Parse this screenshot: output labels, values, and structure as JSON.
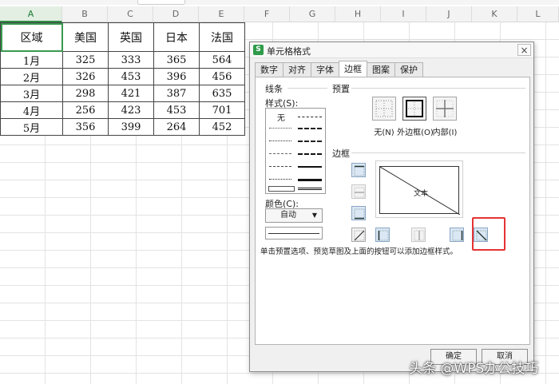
{
  "columns": [
    "A",
    "B",
    "C",
    "D",
    "E",
    "F",
    "G",
    "H",
    "I",
    "J",
    "K",
    "L"
  ],
  "sheet": {
    "header": [
      "区域",
      "美国",
      "英国",
      "日本",
      "法国"
    ],
    "rows": [
      [
        "1月",
        "325",
        "333",
        "365",
        "564"
      ],
      [
        "2月",
        "326",
        "453",
        "396",
        "456"
      ],
      [
        "3月",
        "298",
        "421",
        "387",
        "635"
      ],
      [
        "4月",
        "256",
        "423",
        "453",
        "701"
      ],
      [
        "5月",
        "356",
        "399",
        "264",
        "452"
      ]
    ]
  },
  "dialog": {
    "title": "单元格格式",
    "close_glyph": "×",
    "logo_glyph": "S",
    "tabs": [
      "数字",
      "对齐",
      "字体",
      "边框",
      "图案",
      "保护"
    ],
    "active_tab": "边框",
    "line_group": "线条",
    "style_label": "样式(S):",
    "style_none": "无",
    "color_label": "颜色(C):",
    "color_value": "自动",
    "preset_group": "预置",
    "presets": [
      "无(N)",
      "外边框(O)",
      "内部(I)"
    ],
    "border_group": "边框",
    "preview_text": "文本",
    "hint": "单击预置选项、预览草图及上面的按钮可以添加边框样式。",
    "ok": "确定",
    "cancel": "取消"
  },
  "colors": {
    "accent": "#2e9b4a",
    "highlight": "#e53333",
    "button_blue": "#dbe7f4"
  },
  "watermark": "头条 @WPS办公技巧"
}
